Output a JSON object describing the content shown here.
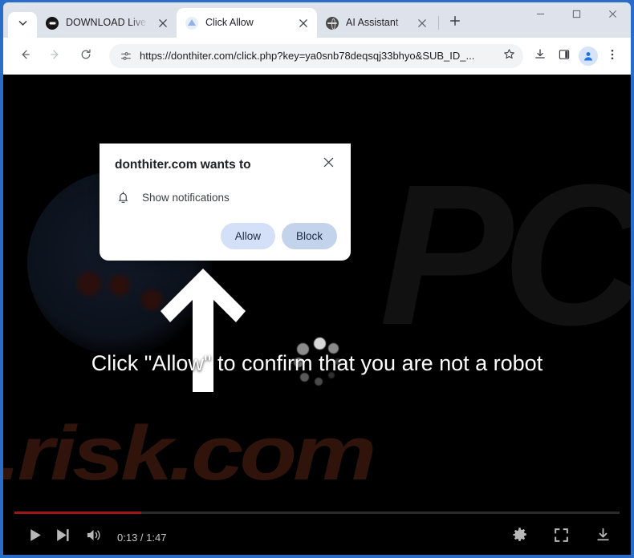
{
  "browser": {
    "tab_search_icon": "chevron-down-icon",
    "tabs": [
      {
        "title": "DOWNLOAD Live You",
        "favicon": "dark-circle-icon",
        "active": false
      },
      {
        "title": "Click Allow",
        "favicon": "blue-shape-icon",
        "active": true
      },
      {
        "title": "AI Assistant",
        "favicon": "globe-icon",
        "active": false
      }
    ],
    "new_tab_label": "+",
    "window_controls": {
      "minimize": "minimize-icon",
      "maximize": "maximize-icon",
      "close": "close-icon"
    },
    "toolbar": {
      "back_icon": "back-arrow-icon",
      "forward_icon": "forward-arrow-icon",
      "reload_icon": "reload-icon",
      "site_info_icon": "site-settings-icon",
      "url": "https://donthiter.com/click.php?key=ya0snb78deqsqj33bhyo&SUB_ID_...",
      "bookmark_icon": "star-icon",
      "downloads_icon": "download-icon",
      "sidepanel_icon": "side-panel-icon",
      "profile_icon": "profile-avatar-icon",
      "menu_icon": "three-dot-menu-icon"
    }
  },
  "notification_dialog": {
    "title": "donthiter.com wants to",
    "close_icon": "close-icon",
    "permission_icon": "bell-icon",
    "permission_label": "Show notifications",
    "allow_label": "Allow",
    "block_label": "Block",
    "allow_color": "#d3e0f7",
    "block_color": "#c3d3ec"
  },
  "page_content": {
    "headline": "Click \"Allow\" to confirm that you are not a robot",
    "arrow_icon": "up-arrow-icon",
    "spinner_icon": "loading-spinner-icon",
    "watermark_bottom": ".risk.com",
    "watermark_top": "PC",
    "background_color": "#000000",
    "text_color": "#ffffff"
  },
  "player": {
    "play_icon": "play-icon",
    "next_icon": "next-track-icon",
    "volume_icon": "volume-icon",
    "time_display": "0:13 / 1:47",
    "current_time": "0:13",
    "duration": "1:47",
    "progress_percent": 21,
    "progress_color": "#9c1616",
    "settings_icon": "gear-icon",
    "fullscreen_icon": "fullscreen-icon",
    "download_icon": "download-icon"
  }
}
